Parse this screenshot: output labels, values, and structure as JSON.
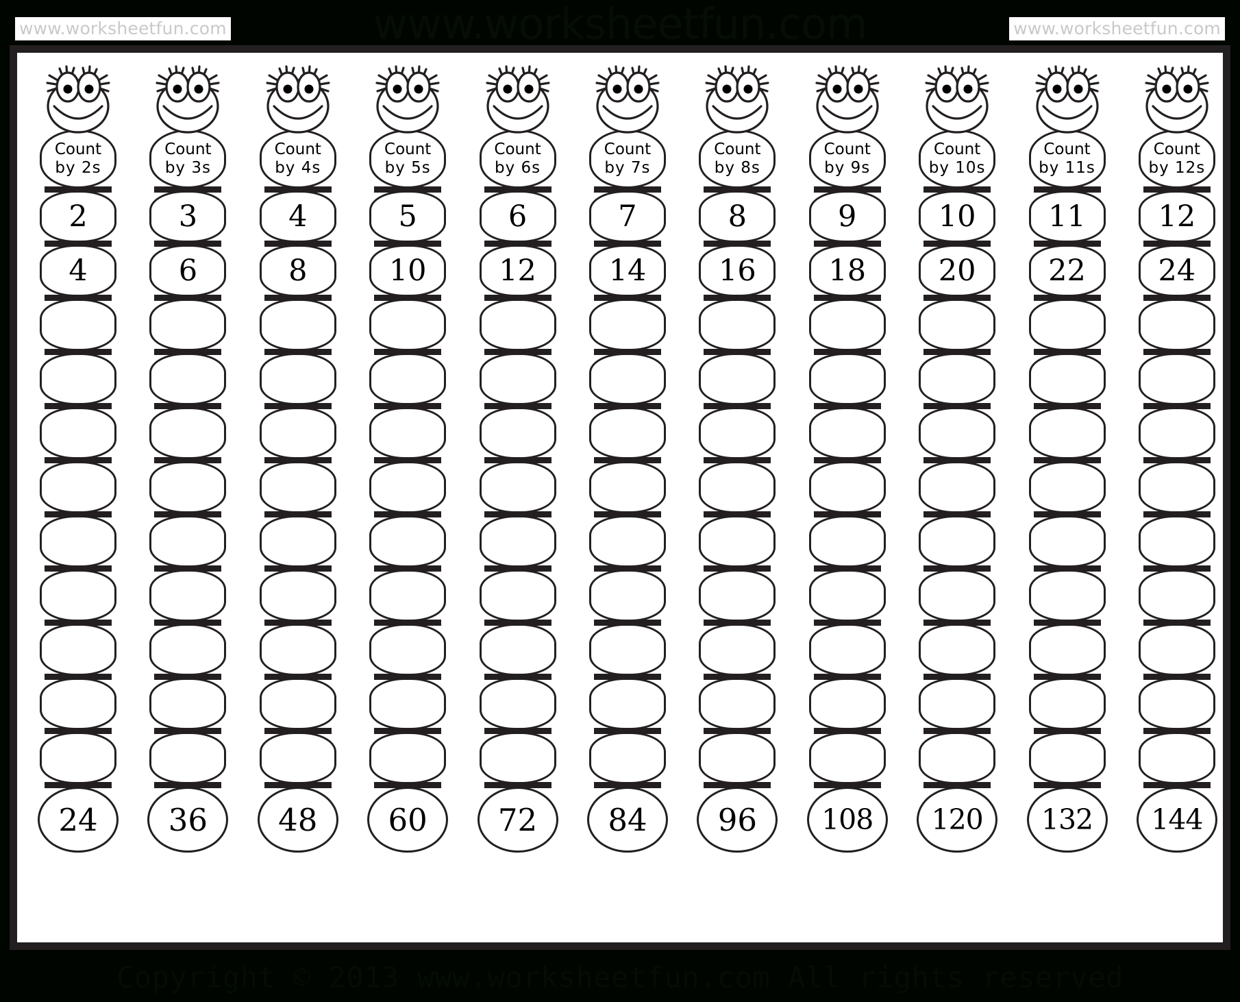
{
  "banner": {
    "watermark_left": "www.worksheetfun.com",
    "watermark_center": "www.worksheetfun.com",
    "watermark_right": "www.worksheetfun.com"
  },
  "footer": {
    "copyright": "Copyright © 2013 www.worksheetfun.com All rights reserved"
  },
  "worksheet": {
    "label_line1": "Count",
    "segment_count": 12,
    "colors": {
      "ink": "#231f20",
      "paper": "#ffffff",
      "banner": "#000500",
      "watermark_text": "#c9c9c9"
    }
  },
  "columns": [
    {
      "label_line2": "by 2s",
      "step": 2,
      "segments": [
        "2",
        "4",
        "",
        "",
        "",
        "",
        "",
        "",
        "",
        "",
        "",
        "24"
      ]
    },
    {
      "label_line2": "by 3s",
      "step": 3,
      "segments": [
        "3",
        "6",
        "",
        "",
        "",
        "",
        "",
        "",
        "",
        "",
        "",
        "36"
      ]
    },
    {
      "label_line2": "by 4s",
      "step": 4,
      "segments": [
        "4",
        "8",
        "",
        "",
        "",
        "",
        "",
        "",
        "",
        "",
        "",
        "48"
      ]
    },
    {
      "label_line2": "by 5s",
      "step": 5,
      "segments": [
        "5",
        "10",
        "",
        "",
        "",
        "",
        "",
        "",
        "",
        "",
        "",
        "60"
      ]
    },
    {
      "label_line2": "by 6s",
      "step": 6,
      "segments": [
        "6",
        "12",
        "",
        "",
        "",
        "",
        "",
        "",
        "",
        "",
        "",
        "72"
      ]
    },
    {
      "label_line2": "by 7s",
      "step": 7,
      "segments": [
        "7",
        "14",
        "",
        "",
        "",
        "",
        "",
        "",
        "",
        "",
        "",
        "84"
      ]
    },
    {
      "label_line2": "by 8s",
      "step": 8,
      "segments": [
        "8",
        "16",
        "",
        "",
        "",
        "",
        "",
        "",
        "",
        "",
        "",
        "96"
      ]
    },
    {
      "label_line2": "by 9s",
      "step": 9,
      "segments": [
        "9",
        "18",
        "",
        "",
        "",
        "",
        "",
        "",
        "",
        "",
        "",
        "108"
      ]
    },
    {
      "label_line2": "by 10s",
      "step": 10,
      "segments": [
        "10",
        "20",
        "",
        "",
        "",
        "",
        "",
        "",
        "",
        "",
        "",
        "120"
      ]
    },
    {
      "label_line2": "by 11s",
      "step": 11,
      "segments": [
        "11",
        "22",
        "",
        "",
        "",
        "",
        "",
        "",
        "",
        "",
        "",
        "132"
      ]
    },
    {
      "label_line2": "by 12s",
      "step": 12,
      "segments": [
        "12",
        "24",
        "",
        "",
        "",
        "",
        "",
        "",
        "",
        "",
        "",
        "144"
      ]
    }
  ],
  "icons": {
    "head": "caterpillar-face-icon"
  }
}
